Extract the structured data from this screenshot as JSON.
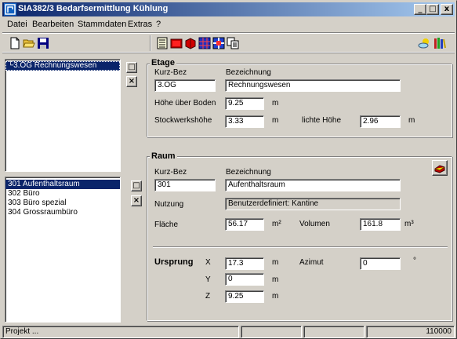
{
  "window": {
    "title": "SIA382/3 Bedarfsermittlung Kühlung"
  },
  "menu": [
    "Datei",
    "Bearbeiten",
    "Stammdaten",
    "Extras",
    "?"
  ],
  "caption_buttons": {
    "minimize": "_",
    "maximize": "□",
    "close": "x"
  },
  "etagen_list": [
    {
      "label": "└3.OG Rechnungswesen",
      "selected": true
    }
  ],
  "raum_list": [
    {
      "label": "301 Aufenthaltsraum",
      "selected": true
    },
    {
      "label": "302 Büro",
      "selected": false
    },
    {
      "label": "303 Büro spezial",
      "selected": false
    },
    {
      "label": "304 Grossraumbüro",
      "selected": false
    }
  ],
  "etage": {
    "title": "Etage",
    "kurzbez_label": "Kurz-Bez",
    "bezeichnung_label": "Bezeichnung",
    "kurzbez": "3.OG",
    "bezeichnung": "Rechnungswesen",
    "hoehe_label": "Höhe über Boden",
    "hoehe": "9.25",
    "hoehe_unit": "m",
    "stockwerk_label": "Stockwerkshöhe",
    "stockwerk": "3.33",
    "stockwerk_unit": "m",
    "lichte_label": "lichte Höhe",
    "lichte": "2.96",
    "lichte_unit": "m"
  },
  "raum": {
    "title": "Raum",
    "kurzbez_label": "Kurz-Bez",
    "bezeichnung_label": "Bezeichnung",
    "kurzbez": "301",
    "bezeichnung": "Aufenthaltsraum",
    "nutzung_label": "Nutzung",
    "nutzung": "Benutzerdefiniert: Kantine",
    "flaeche_label": "Fläche",
    "flaeche": "56.17",
    "flaeche_unit": "m²",
    "volumen_label": "Volumen",
    "volumen": "161.8",
    "volumen_unit": "m³",
    "ursprung_label": "Ursprung",
    "x_label": "X",
    "x": "17.3",
    "y_label": "Y",
    "y": "0",
    "z_label": "Z",
    "z": "9.25",
    "coord_unit": "m",
    "azimut_label": "Azimut",
    "azimut": "0",
    "azimut_unit": "°"
  },
  "buttons": {
    "new": "□",
    "delete": "×"
  },
  "status": {
    "text": "Projekt ...",
    "code": "110000"
  }
}
